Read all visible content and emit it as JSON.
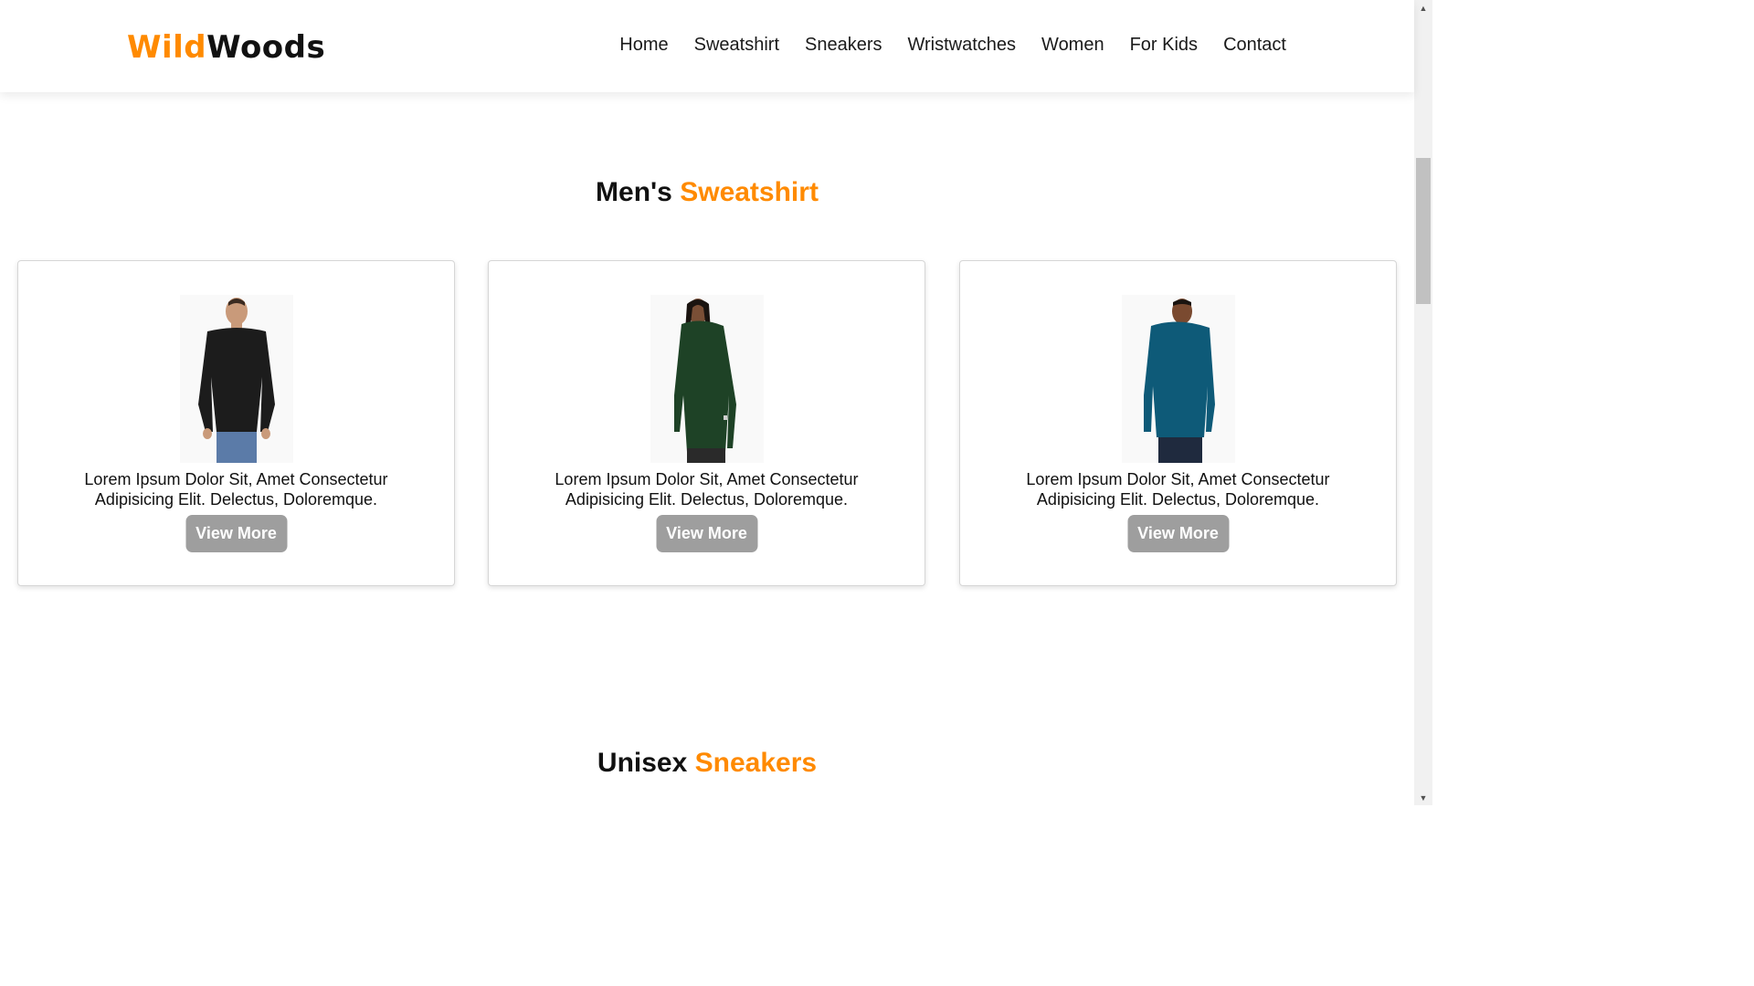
{
  "brand": {
    "part1": "Wild",
    "part2": "Woods"
  },
  "nav": [
    "Home",
    "Sweatshirt",
    "Sneakers",
    "Wristwatches",
    "Women",
    "For Kids",
    "Contact"
  ],
  "sections": [
    {
      "title_plain": "Men's",
      "title_accent": "Sweatshirt"
    },
    {
      "title_plain": "Unisex",
      "title_accent": "Sneakers"
    }
  ],
  "cards": [
    {
      "description_line1": "Lorem Ipsum Dolor Sit, Amet Consectetur",
      "description_line2": "Adipisicing Elit. Delectus, Doloremque.",
      "button_label": "View More",
      "garment_color": "#1c1c1c"
    },
    {
      "description_line1": "Lorem Ipsum Dolor Sit, Amet Consectetur",
      "description_line2": "Adipisicing Elit. Delectus, Doloremque.",
      "button_label": "View More",
      "garment_color": "#1e4226"
    },
    {
      "description_line1": "Lorem Ipsum Dolor Sit, Amet Consectetur",
      "description_line2": "Adipisicing Elit. Delectus, Doloremque.",
      "button_label": "View More",
      "garment_color": "#0e5a78"
    }
  ],
  "colors": {
    "accent": "#ff8a00",
    "button": "#9e9e9e",
    "text": "#111111"
  }
}
